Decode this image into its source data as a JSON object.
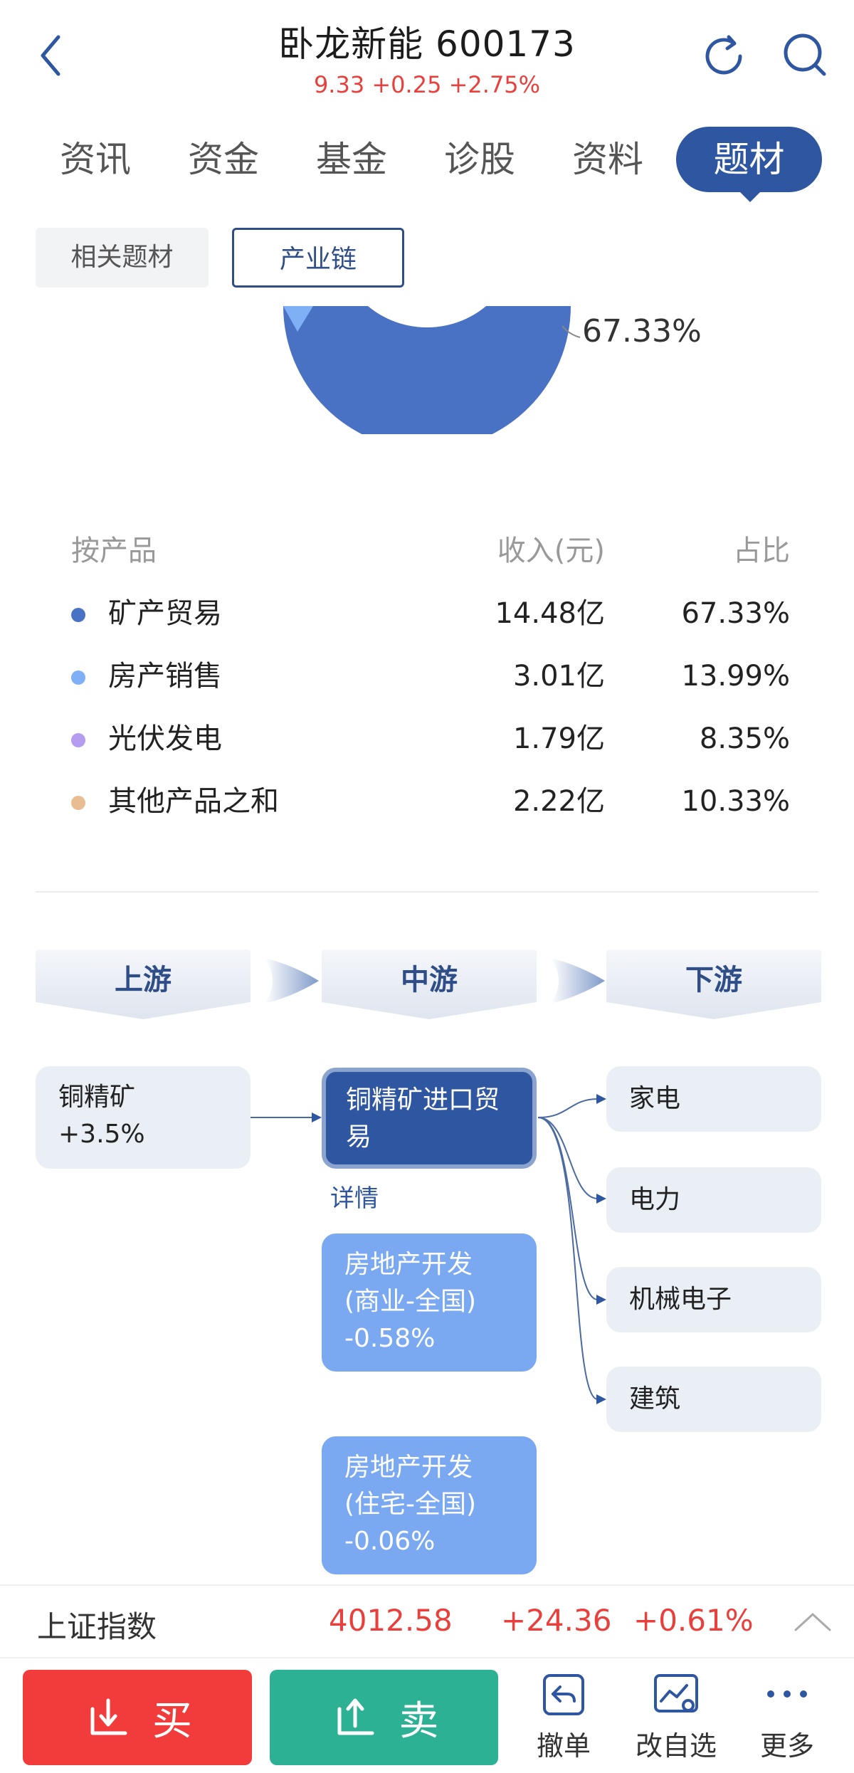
{
  "header": {
    "title": "卧龙新能 600173",
    "quote": "9.33 +0.25 +2.75%"
  },
  "tabs": [
    "资讯",
    "资金",
    "基金",
    "诊股",
    "资料",
    "题材"
  ],
  "active_tab": "题材",
  "subtabs": {
    "related": "相关题材",
    "chain": "产业链"
  },
  "donut": {
    "label": "67.33%"
  },
  "product_table": {
    "headers": [
      "按产品",
      "收入(元)",
      "占比"
    ],
    "rows": [
      {
        "name": "矿产贸易",
        "revenue": "14.48亿",
        "share": "67.33%",
        "color": "#4a72c4"
      },
      {
        "name": "房产销售",
        "revenue": "3.01亿",
        "share": "13.99%",
        "color": "#7fb0f5"
      },
      {
        "name": "光伏发电",
        "revenue": "1.79亿",
        "share": "8.35%",
        "color": "#b49cf0"
      },
      {
        "name": "其他产品之和",
        "revenue": "2.22亿",
        "share": "10.33%",
        "color": "#e8bd92"
      }
    ]
  },
  "chain": {
    "stages": [
      "上游",
      "中游",
      "下游"
    ],
    "upstream": [
      "铜精矿\n+3.5%"
    ],
    "midstream": {
      "main": "铜精矿进口贸易",
      "detail": "详情",
      "others": [
        "房地产开发\n(商业-全国)\n-0.58%",
        "房地产开发\n(住宅-全国)\n-0.06%"
      ]
    },
    "downstream": [
      "家电",
      "电力",
      "机械电子",
      "建筑"
    ]
  },
  "index_bar": {
    "name": "上证指数",
    "value": "4012.58",
    "change": "+24.36",
    "pct": "+0.61%"
  },
  "bottom": {
    "buy": "买",
    "sell": "卖",
    "tools": [
      "撤单",
      "改自选",
      "更多"
    ]
  },
  "colors": {
    "accent": "#2f56a0",
    "up": "#e8403c",
    "buy": "#f23b3b",
    "sell": "#2db195"
  }
}
